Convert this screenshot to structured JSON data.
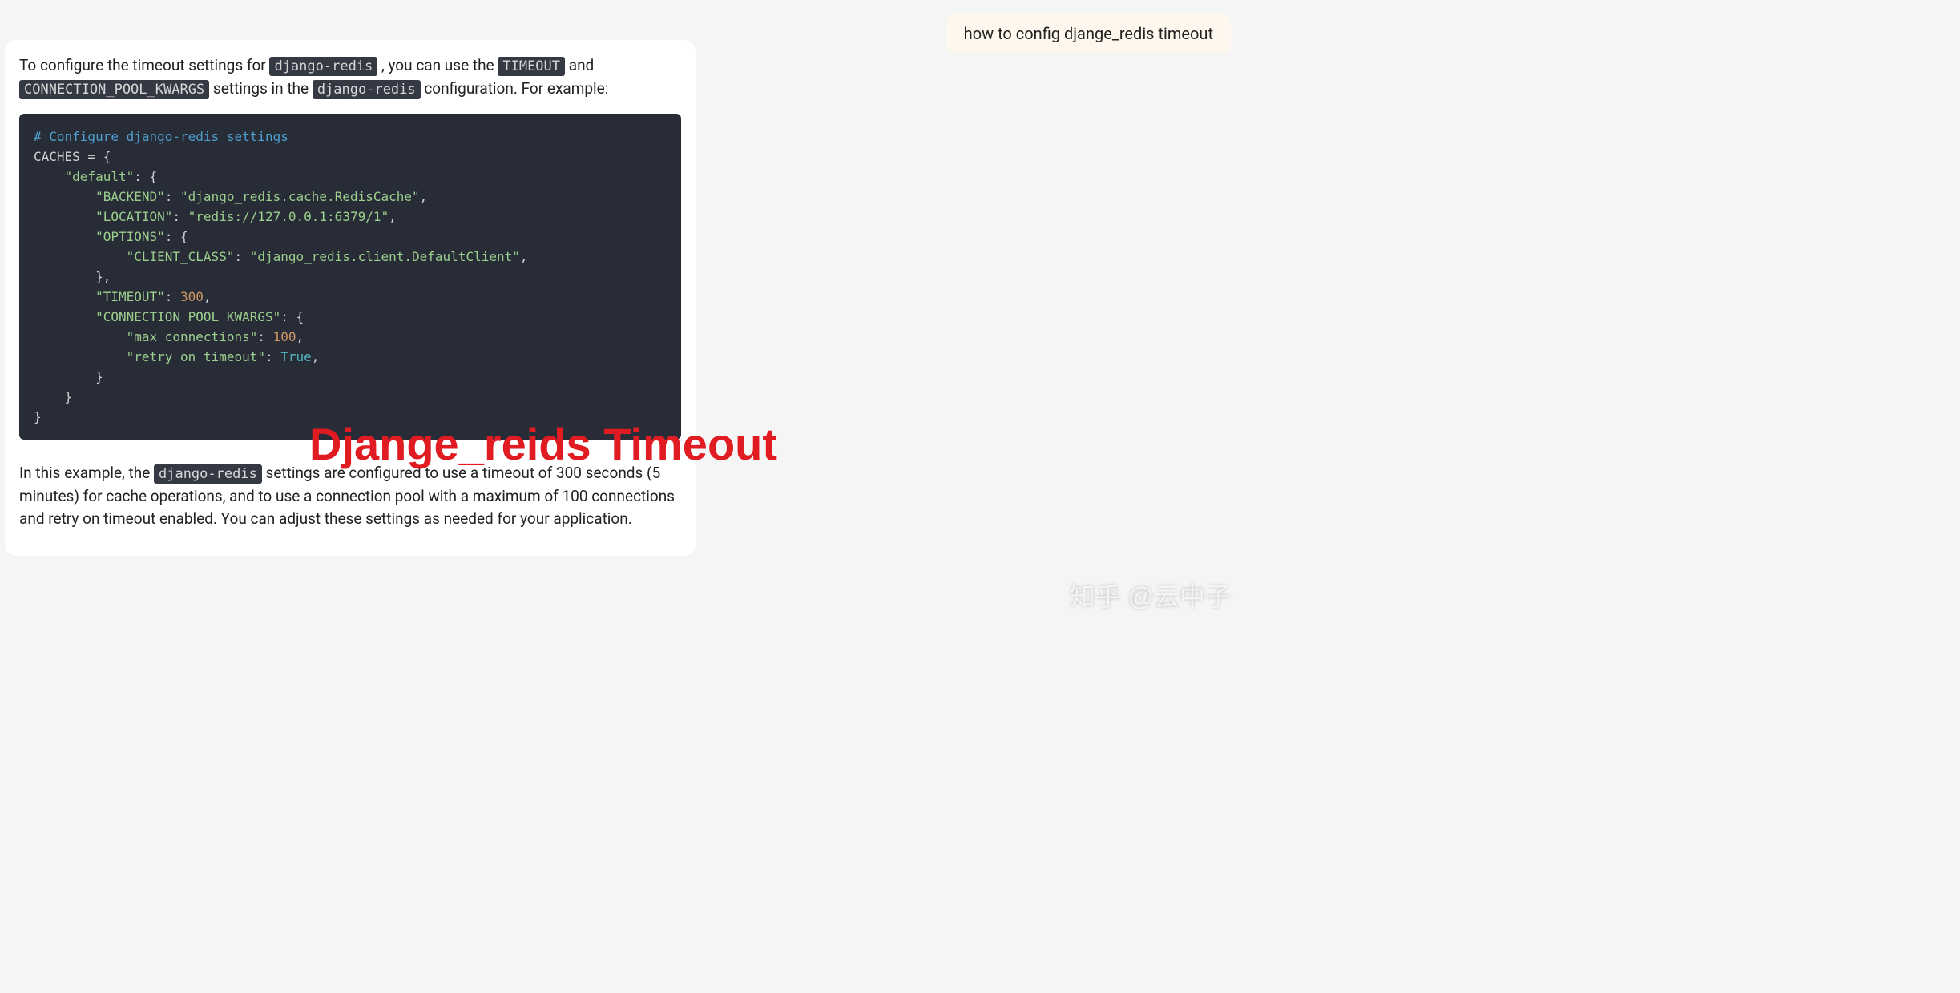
{
  "user_message": "how to config djange_redis timeout",
  "answer": {
    "p1_a": "To configure the timeout settings for ",
    "p1_code1": "django-redis",
    "p1_b": ", you can use the ",
    "p1_code2": "TIMEOUT",
    "p1_c": " and ",
    "p1_code3": "CONNECTION_POOL_KWARGS",
    "p1_d": " settings in the ",
    "p1_code4": "django-redis",
    "p1_e": " configuration. For example:",
    "code": {
      "comment": "# Configure django-redis settings",
      "l2a": "CACHES = {",
      "l3a": "\"default\"",
      "l4k": "\"BACKEND\"",
      "l4v": "\"django_redis.cache.RedisCache\"",
      "l5k": "\"LOCATION\"",
      "l5v": "\"redis://127.0.0.1:6379/1\"",
      "l6k": "\"OPTIONS\"",
      "l7k": "\"CLIENT_CLASS\"",
      "l7v": "\"django_redis.client.DefaultClient\"",
      "l9k": "\"TIMEOUT\"",
      "l9v": "300",
      "l10k": "\"CONNECTION_POOL_KWARGS\"",
      "l11k": "\"max_connections\"",
      "l11v": "100",
      "l12k": "\"retry_on_timeout\"",
      "l12v": "True"
    },
    "p2_a": "In this example, the ",
    "p2_code1": "django-redis",
    "p2_b": " settings are configured to use a timeout of 300 seconds (5 minutes) for cache operations, and to use a connection pool with a maximum of 100 connections and retry on timeout enabled. You can adjust these settings as needed for your application."
  },
  "overlay_title": "Djange_reids Timeout",
  "watermark": "知乎 @云中子"
}
